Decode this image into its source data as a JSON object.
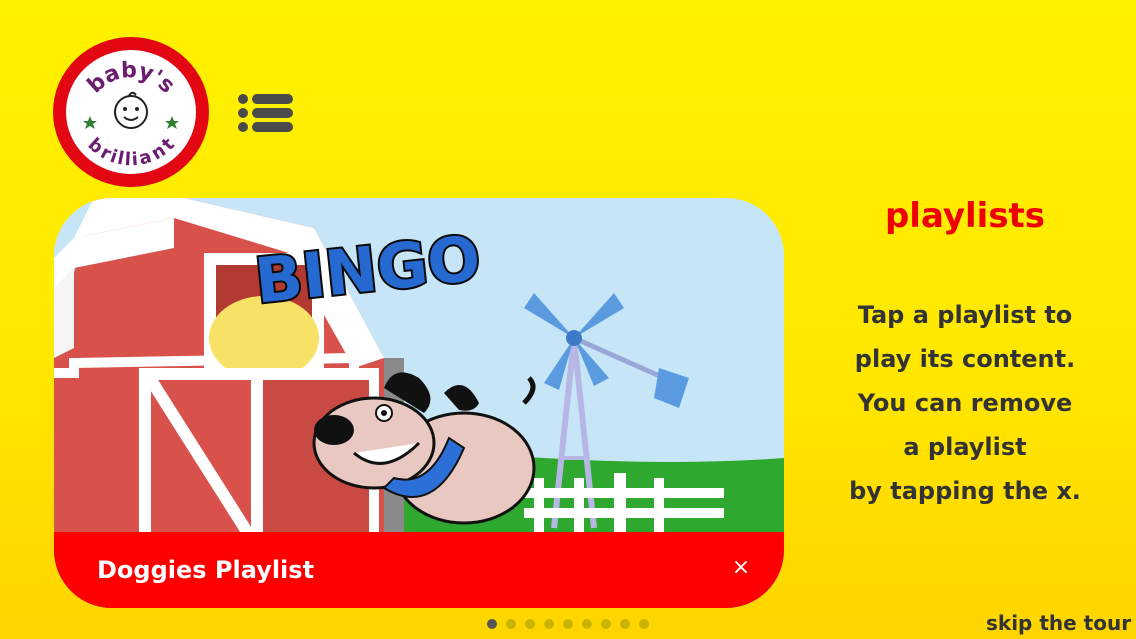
{
  "logo": {
    "text_top": "baby's",
    "text_bottom": "brilliant",
    "icon": "baby-face-icon",
    "ring_color": "#e30613"
  },
  "menu": {
    "icon": "list-menu-icon"
  },
  "card": {
    "title": "Doggies Playlist",
    "close_label": "×",
    "thumbnail_text": "BINGO",
    "bar_color": "#ff0000"
  },
  "tour": {
    "heading": "playlists",
    "lines": [
      "Tap a playlist to",
      "play its content.",
      "You can remove",
      "a playlist",
      "by tapping the x."
    ],
    "skip_label": "skip the tour",
    "page_count": 9,
    "active_page": 1
  },
  "colors": {
    "background": "#fff200",
    "heading": "#ee0000",
    "text": "#333333"
  }
}
